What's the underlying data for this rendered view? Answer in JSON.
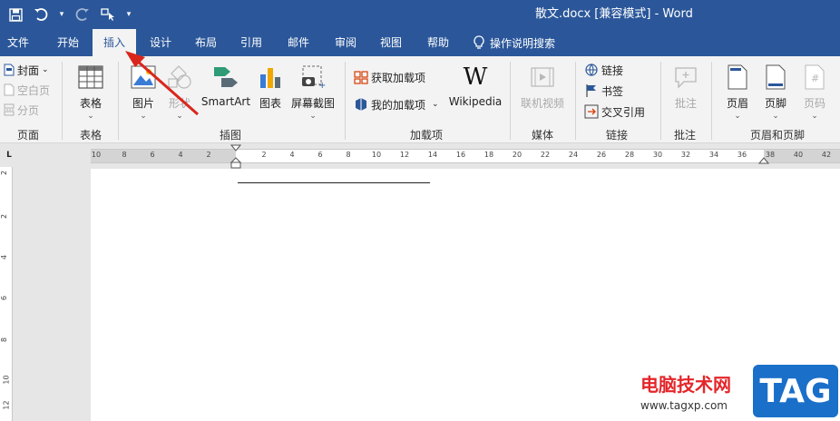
{
  "window": {
    "title": "散文.docx [兼容模式]  -  Word"
  },
  "qat": {
    "save_icon": "save-icon",
    "undo_icon": "undo-icon",
    "redo_icon": "redo-icon",
    "touch_icon": "touch-mode-icon",
    "customize_icon": "customize-qat-icon"
  },
  "tabs": [
    {
      "label": "文件"
    },
    {
      "label": "开始"
    },
    {
      "label": "插入"
    },
    {
      "label": "设计"
    },
    {
      "label": "布局"
    },
    {
      "label": "引用"
    },
    {
      "label": "邮件"
    },
    {
      "label": "审阅"
    },
    {
      "label": "视图"
    },
    {
      "label": "帮助"
    }
  ],
  "tell_me": "操作说明搜索",
  "ribbon": {
    "pages": {
      "cover": "封面",
      "blank": "空白页",
      "break": "分页",
      "label": "页面"
    },
    "tables": {
      "table": "表格",
      "label": "表格"
    },
    "illustrations": {
      "pictures": "图片",
      "shapes": "形状",
      "smartart": "SmartArt",
      "chart": "图表",
      "screenshot": "屏幕截图",
      "label": "插图"
    },
    "addins": {
      "get": "获取加载项",
      "mine": "我的加载项",
      "wikipedia": "Wikipedia",
      "label": "加载项"
    },
    "media": {
      "video": "联机视频",
      "label": "媒体"
    },
    "links": {
      "link": "链接",
      "bookmark": "书签",
      "crossref": "交叉引用",
      "label": "链接"
    },
    "comments": {
      "comment": "批注",
      "label": "批注"
    },
    "header_footer": {
      "header": "页眉",
      "footer": "页脚",
      "page_number": "页码",
      "label": "页眉和页脚"
    }
  },
  "ruler": {
    "corner": "L",
    "left_ticks": [
      "10",
      "8",
      "6",
      "4",
      "2"
    ],
    "right_ticks": [
      "2",
      "4",
      "6",
      "8",
      "10",
      "12",
      "14",
      "16",
      "18",
      "20",
      "22",
      "24",
      "26",
      "28",
      "30",
      "32",
      "34",
      "36",
      "38",
      "40",
      "42"
    ],
    "vertical_ticks": [
      "2",
      "2",
      "4",
      "6",
      "8",
      "10",
      "12",
      "14"
    ]
  },
  "watermark": {
    "text": "电脑技术网",
    "url": "www.tagxp.com",
    "badge": "TAG"
  },
  "colors": {
    "accent": "#2b579a",
    "annotation_arrow": "#d9261c",
    "ribbon_bg": "#f3f3f3"
  }
}
